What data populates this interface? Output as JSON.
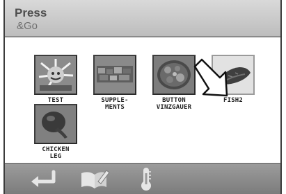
{
  "header": {
    "brand_line1": "Press",
    "brand_line2": "&Go"
  },
  "grid": {
    "items": [
      {
        "line1": "TEST",
        "line2": "",
        "icon": "test-image-icon",
        "selected": false
      },
      {
        "line1": "SUPPLE-",
        "line2": "MENTS",
        "icon": "supplements-icon",
        "selected": false
      },
      {
        "line1": "BUTTON",
        "line2": "VINZGAUER",
        "icon": "button-vinzgauer-icon",
        "selected": false
      },
      {
        "line1": "FISH2",
        "line2": "",
        "icon": "fish-icon",
        "selected": true
      },
      {
        "line1": "CHICKEN",
        "line2": "LEG",
        "icon": "chicken-leg-icon",
        "selected": false
      }
    ]
  },
  "bottombar": {
    "buttons": [
      {
        "icon": "back-arrow-icon"
      },
      {
        "icon": "recipe-book-icon"
      },
      {
        "icon": "thermometer-icon"
      }
    ]
  },
  "colors": {
    "titlebar": "#cccccc",
    "bottombar": "#8c8c8c",
    "tile_border": "#3d3d3d",
    "selected_tile": "#e4e4e4"
  }
}
